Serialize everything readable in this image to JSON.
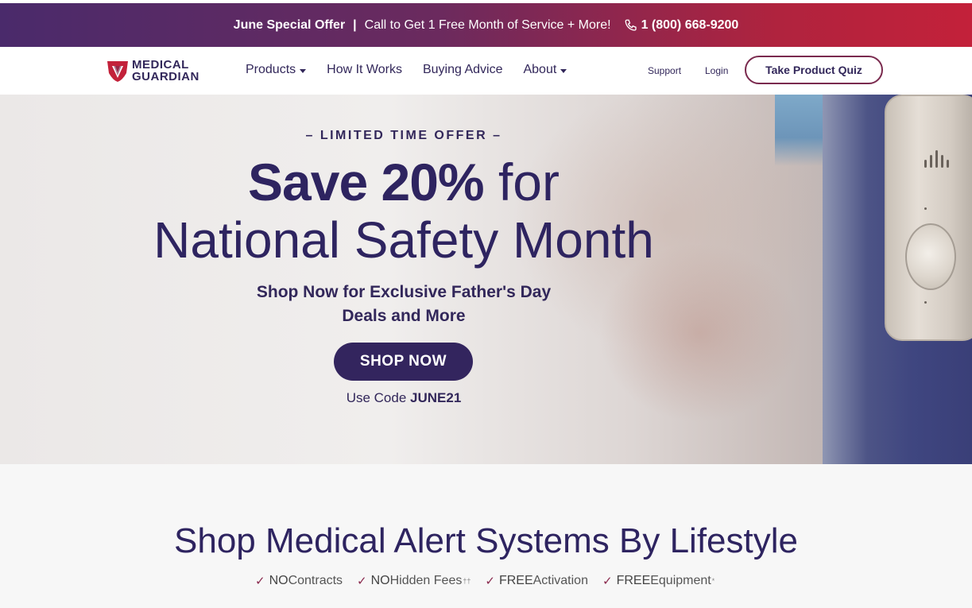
{
  "promo": {
    "offer_title": "June Special Offer",
    "separator": "|",
    "offer_text": "Call to Get 1 Free Month of Service + More!",
    "phone_icon": "phone-icon",
    "phone": "1 (800) 668-9200"
  },
  "header": {
    "logo_line1": "MEDICAL",
    "logo_line2": "GUARDIAN",
    "nav": [
      {
        "label": "Products",
        "has_dropdown": true
      },
      {
        "label": "How It Works",
        "has_dropdown": false
      },
      {
        "label": "Buying Advice",
        "has_dropdown": false
      },
      {
        "label": "About",
        "has_dropdown": true
      }
    ],
    "support": "Support",
    "login": "Login",
    "quiz_button": "Take Product Quiz"
  },
  "hero": {
    "eyebrow": "– LIMITED TIME OFFER –",
    "headline_bold": "Save 20%",
    "headline_light": " for",
    "headline_line2": "National Safety Month",
    "subhead_line1": "Shop Now for Exclusive Father's Day",
    "subhead_line2": "Deals and More",
    "cta": "SHOP NOW",
    "code_prefix": "Use Code ",
    "code": "JUNE21"
  },
  "lifestyle": {
    "title": "Shop Medical Alert Systems By Lifestyle",
    "features": [
      {
        "strong": "NO",
        "text": " Contracts",
        "mark": ""
      },
      {
        "strong": "NO",
        "text": " Hidden Fees",
        "mark": "††"
      },
      {
        "strong": "FREE",
        "text": " Activation",
        "mark": ""
      },
      {
        "strong": "FREE",
        "text": " Equipment",
        "mark": "*"
      }
    ]
  },
  "colors": {
    "brand_purple": "#32275a",
    "brand_red": "#c3213a",
    "check_color": "#8a2a4e"
  }
}
